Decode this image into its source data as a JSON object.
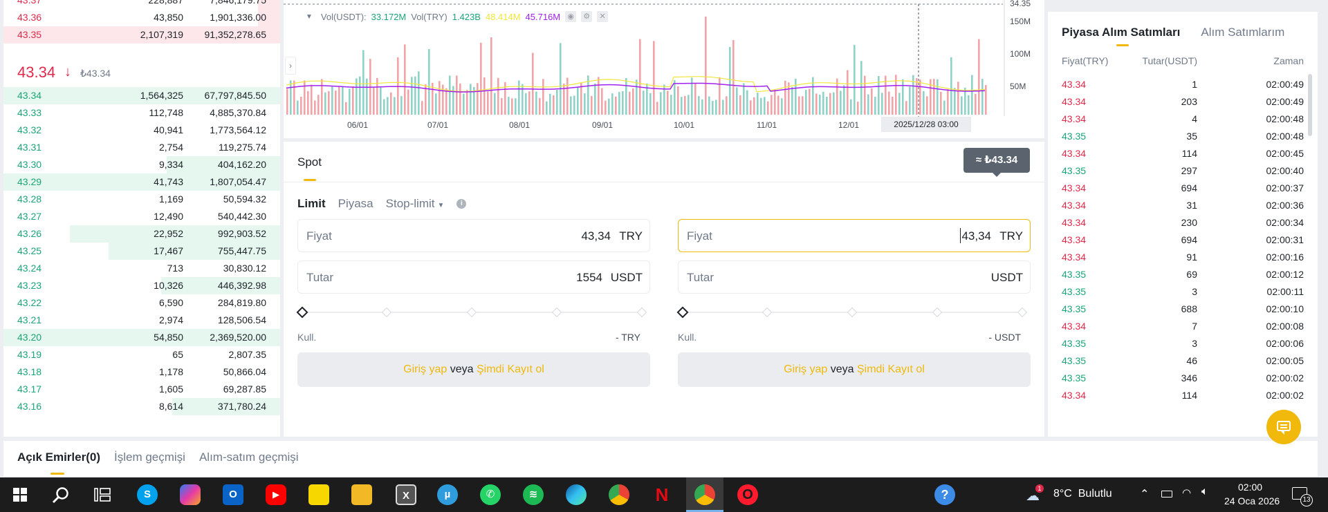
{
  "orderbook": {
    "asks": [
      {
        "price": "43.37",
        "amount": "228,887",
        "total": "7,846,179.75",
        "depth": 0.08
      },
      {
        "price": "43.36",
        "amount": "43,850",
        "total": "1,901,336.00",
        "depth": 0.08
      },
      {
        "price": "43.35",
        "amount": "2,107,319",
        "total": "91,352,278.65",
        "depth": 1.0
      }
    ],
    "last_price": "43.34",
    "last_price_sub": "₺43.34",
    "bids": [
      {
        "price": "43.34",
        "amount": "1,564,325",
        "total": "67,797,845.50",
        "depth": 1.0
      },
      {
        "price": "43.33",
        "amount": "112,748",
        "total": "4,885,370.84",
        "depth": 0.0
      },
      {
        "price": "43.32",
        "amount": "40,941",
        "total": "1,773,564.12",
        "depth": 0.0
      },
      {
        "price": "43.31",
        "amount": "2,754",
        "total": "119,275.74",
        "depth": 0.0
      },
      {
        "price": "43.30",
        "amount": "9,334",
        "total": "404,162.20",
        "depth": 0.41
      },
      {
        "price": "43.29",
        "amount": "41,743",
        "total": "1,807,054.47",
        "depth": 1.0
      },
      {
        "price": "43.28",
        "amount": "1,169",
        "total": "50,594.32",
        "depth": 0.0
      },
      {
        "price": "43.27",
        "amount": "12,490",
        "total": "540,442.30",
        "depth": 0.0
      },
      {
        "price": "43.26",
        "amount": "22,952",
        "total": "992,903.52",
        "depth": 0.76
      },
      {
        "price": "43.25",
        "amount": "17,467",
        "total": "755,447.75",
        "depth": 0.62
      },
      {
        "price": "43.24",
        "amount": "713",
        "total": "30,830.12",
        "depth": 0.0
      },
      {
        "price": "43.23",
        "amount": "10,326",
        "total": "446,392.98",
        "depth": 0.43
      },
      {
        "price": "43.22",
        "amount": "6,590",
        "total": "284,819.80",
        "depth": 0.0
      },
      {
        "price": "43.21",
        "amount": "2,974",
        "total": "128,506.54",
        "depth": 0.0
      },
      {
        "price": "43.20",
        "amount": "54,850",
        "total": "2,369,520.00",
        "depth": 1.0
      },
      {
        "price": "43.19",
        "amount": "65",
        "total": "2,807.35",
        "depth": 0.0
      },
      {
        "price": "43.18",
        "amount": "1,178",
        "total": "50,866.04",
        "depth": 0.0
      },
      {
        "price": "43.17",
        "amount": "1,605",
        "total": "69,287.85",
        "depth": 0.0
      },
      {
        "price": "43.16",
        "amount": "8,614",
        "total": "371,780.24",
        "depth": 0.39
      }
    ]
  },
  "chart": {
    "legend": {
      "prefix": "Vol(USDT):",
      "vol_usdt": "33.172M",
      "vol_try_label": "Vol(TRY)",
      "vol_try": "1.423B",
      "ma1": "48.414M",
      "ma2": "45.716M"
    },
    "colors": {
      "ma1": "#f0e63c",
      "ma2": "#a020f0",
      "up": "#26a69a",
      "down": "#ef5350",
      "vol_usdt": "#1aa676"
    },
    "x_labels": [
      "06/01",
      "07/01",
      "08/01",
      "09/01",
      "10/01",
      "11/01",
      "12/01"
    ],
    "y_labels": [
      "34.35",
      "150M",
      "100M",
      "50M"
    ],
    "crosshair_label": "2025/12/28 03:00"
  },
  "spot": {
    "tab": "Spot",
    "order_types": [
      "Limit",
      "Piyasa",
      "Stop-limit"
    ],
    "tooltip": "≈ ₺43.34",
    "buy": {
      "price_label": "Fiyat",
      "price_value": "43,34",
      "price_unit": "TRY",
      "amount_label": "Tutar",
      "amount_value": "1554",
      "amount_unit": "USDT",
      "avail_label": "Kull.",
      "avail_value": "- TRY"
    },
    "sell": {
      "price_label": "Fiyat",
      "price_value": "43,34",
      "price_unit": "TRY",
      "amount_label": "Tutar",
      "amount_value": "",
      "amount_unit": "USDT",
      "avail_label": "Kull.",
      "avail_value": "- USDT"
    },
    "login": {
      "login": "Giriş yap",
      "or": "veya",
      "register": "Şimdi Kayıt ol"
    }
  },
  "trades": {
    "tabs": [
      "Piyasa Alım Satımları",
      "Alım Satımlarım"
    ],
    "headers": [
      "Fiyat(TRY)",
      "Tutar(USDT)",
      "Zaman"
    ],
    "rows": [
      {
        "price": "43.34",
        "amount": "1",
        "time": "02:00:49",
        "dir": "down"
      },
      {
        "price": "43.34",
        "amount": "203",
        "time": "02:00:49",
        "dir": "down"
      },
      {
        "price": "43.34",
        "amount": "4",
        "time": "02:00:48",
        "dir": "down"
      },
      {
        "price": "43.35",
        "amount": "35",
        "time": "02:00:48",
        "dir": "up"
      },
      {
        "price": "43.34",
        "amount": "114",
        "time": "02:00:45",
        "dir": "down"
      },
      {
        "price": "43.35",
        "amount": "297",
        "time": "02:00:40",
        "dir": "up"
      },
      {
        "price": "43.34",
        "amount": "694",
        "time": "02:00:37",
        "dir": "down"
      },
      {
        "price": "43.34",
        "amount": "31",
        "time": "02:00:36",
        "dir": "down"
      },
      {
        "price": "43.34",
        "amount": "230",
        "time": "02:00:34",
        "dir": "down"
      },
      {
        "price": "43.34",
        "amount": "694",
        "time": "02:00:31",
        "dir": "down"
      },
      {
        "price": "43.34",
        "amount": "91",
        "time": "02:00:16",
        "dir": "down"
      },
      {
        "price": "43.35",
        "amount": "69",
        "time": "02:00:12",
        "dir": "up"
      },
      {
        "price": "43.35",
        "amount": "3",
        "time": "02:00:11",
        "dir": "up"
      },
      {
        "price": "43.35",
        "amount": "688",
        "time": "02:00:10",
        "dir": "up"
      },
      {
        "price": "43.34",
        "amount": "7",
        "time": "02:00:08",
        "dir": "down"
      },
      {
        "price": "43.35",
        "amount": "3",
        "time": "02:00:06",
        "dir": "up"
      },
      {
        "price": "43.35",
        "amount": "46",
        "time": "02:00:05",
        "dir": "up"
      },
      {
        "price": "43.35",
        "amount": "346",
        "time": "02:00:02",
        "dir": "up"
      },
      {
        "price": "43.34",
        "amount": "114",
        "time": "02:00:02",
        "dir": "down"
      }
    ]
  },
  "bottom_tabs": [
    "Açık Emirler(0)",
    "İşlem geçmişi",
    "Alım-satım geçmişi"
  ],
  "taskbar": {
    "weather": "8°C  Bulutlu",
    "weather_badge": "1",
    "time": "02:00",
    "date": "24 Oca 2026",
    "notif_count": "13"
  }
}
